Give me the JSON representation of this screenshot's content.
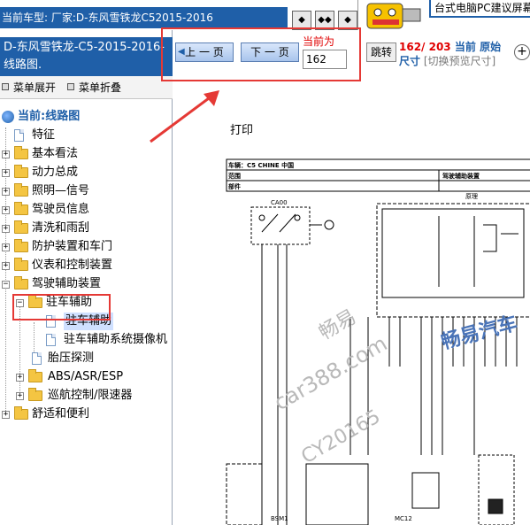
{
  "topbar": {
    "model_label": "当前车型:  厂家:D-东风雪铁龙C52015-2016",
    "ad_text": "台式电脑PC建议屏幕"
  },
  "sidebar": {
    "doc_title": "D-东风雪铁龙-C5-2015-2016- 线路图.",
    "expand_all": "菜单展开",
    "collapse_all": "菜单折叠",
    "tree": [
      {
        "label": "当前:线路图"
      },
      {
        "label": "特征"
      },
      {
        "label": "基本看法"
      },
      {
        "label": "动力总成"
      },
      {
        "label": "照明—信号"
      },
      {
        "label": "驾驶员信息"
      },
      {
        "label": "清洗和雨刮"
      },
      {
        "label": "防护装置和车门"
      },
      {
        "label": "仪表和控制装置"
      },
      {
        "label": "驾驶辅助装置"
      },
      {
        "label": "驻车辅助"
      },
      {
        "label": "驻车辅助"
      },
      {
        "label": "驻车辅助系统摄像机"
      },
      {
        "label": "胎压探测"
      },
      {
        "label": "ABS/ASR/ESP"
      },
      {
        "label": "巡航控制/限速器"
      },
      {
        "label": "舒适和便利"
      }
    ]
  },
  "toolbar": {
    "prev_label": "上 一 页",
    "next_label": "下 一 页",
    "current_label": "当前为",
    "page_value": "162",
    "jump_label": "跳转",
    "page_count": "162/ 203",
    "current_mode": "当前",
    "original_label": "原始",
    "size_label": "尺寸",
    "toggle_preview": "[切换预览尺寸]",
    "zoom_symbol": "+"
  },
  "document": {
    "print_label": "打印",
    "header_vehicle": "车辆：C5 CHINE 中国",
    "header_scope": "范围",
    "header_part": "部件",
    "header_function": "驾驶辅助装置",
    "header_principle": "原理",
    "connector_top": "CA00",
    "watermark_1": "畅易",
    "watermark_2": "car388.com",
    "watermark_3": "CY20165",
    "watermark_brand": "畅易汽车",
    "bottom_label_1": "MC12",
    "bottom_label_2": "BSM1"
  }
}
